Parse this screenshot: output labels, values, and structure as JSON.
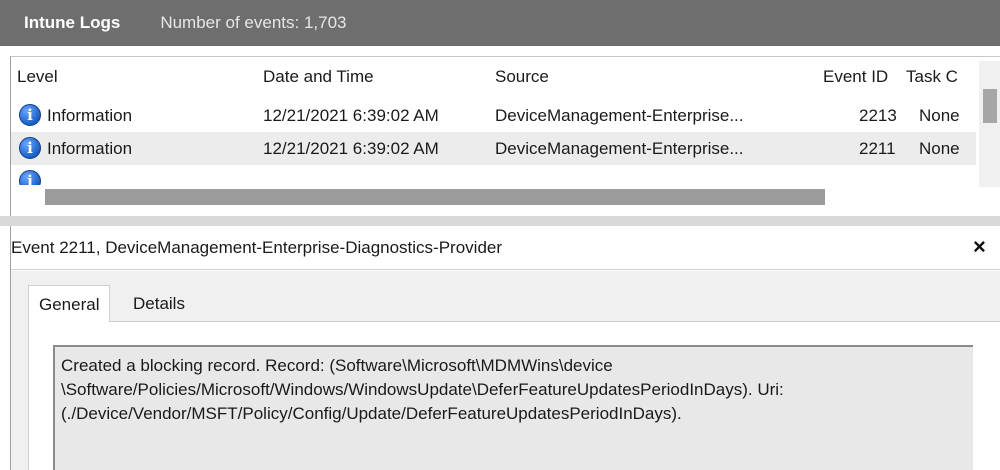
{
  "header": {
    "title": "Intune Logs",
    "event_count": "Number of events: 1,703"
  },
  "table": {
    "columns": [
      "Level",
      "Date and Time",
      "Source",
      "Event ID",
      "Task C"
    ],
    "rows": [
      {
        "level": "Information",
        "datetime": "12/21/2021 6:39:02 AM",
        "source": "DeviceManagement-Enterprise...",
        "event_id": "2213",
        "task": "None"
      },
      {
        "level": "Information",
        "datetime": "12/21/2021 6:39:02 AM",
        "source": "DeviceManagement-Enterprise...",
        "event_id": "2211",
        "task": "None"
      }
    ],
    "info_icon_glyph": "i"
  },
  "detail": {
    "title": "Event 2211, DeviceManagement-Enterprise-Diagnostics-Provider",
    "close_glyph": "×",
    "tabs": [
      "General",
      "Details"
    ],
    "message_lines": [
      "Created a blocking record. Record: (Software\\Microsoft\\MDMWins\\device",
      "\\Software/Policies/Microsoft/Windows/WindowsUpdate\\DeferFeatureUpdatesPeriodInDays). Uri:",
      "(./Device/Vendor/MSFT/Policy/Config/Update/DeferFeatureUpdatesPeriodInDays)."
    ]
  },
  "colors": {
    "titlebar": "#6e6e6e",
    "selected_row": "#ececec",
    "info_icon": "#1b5fc4"
  }
}
